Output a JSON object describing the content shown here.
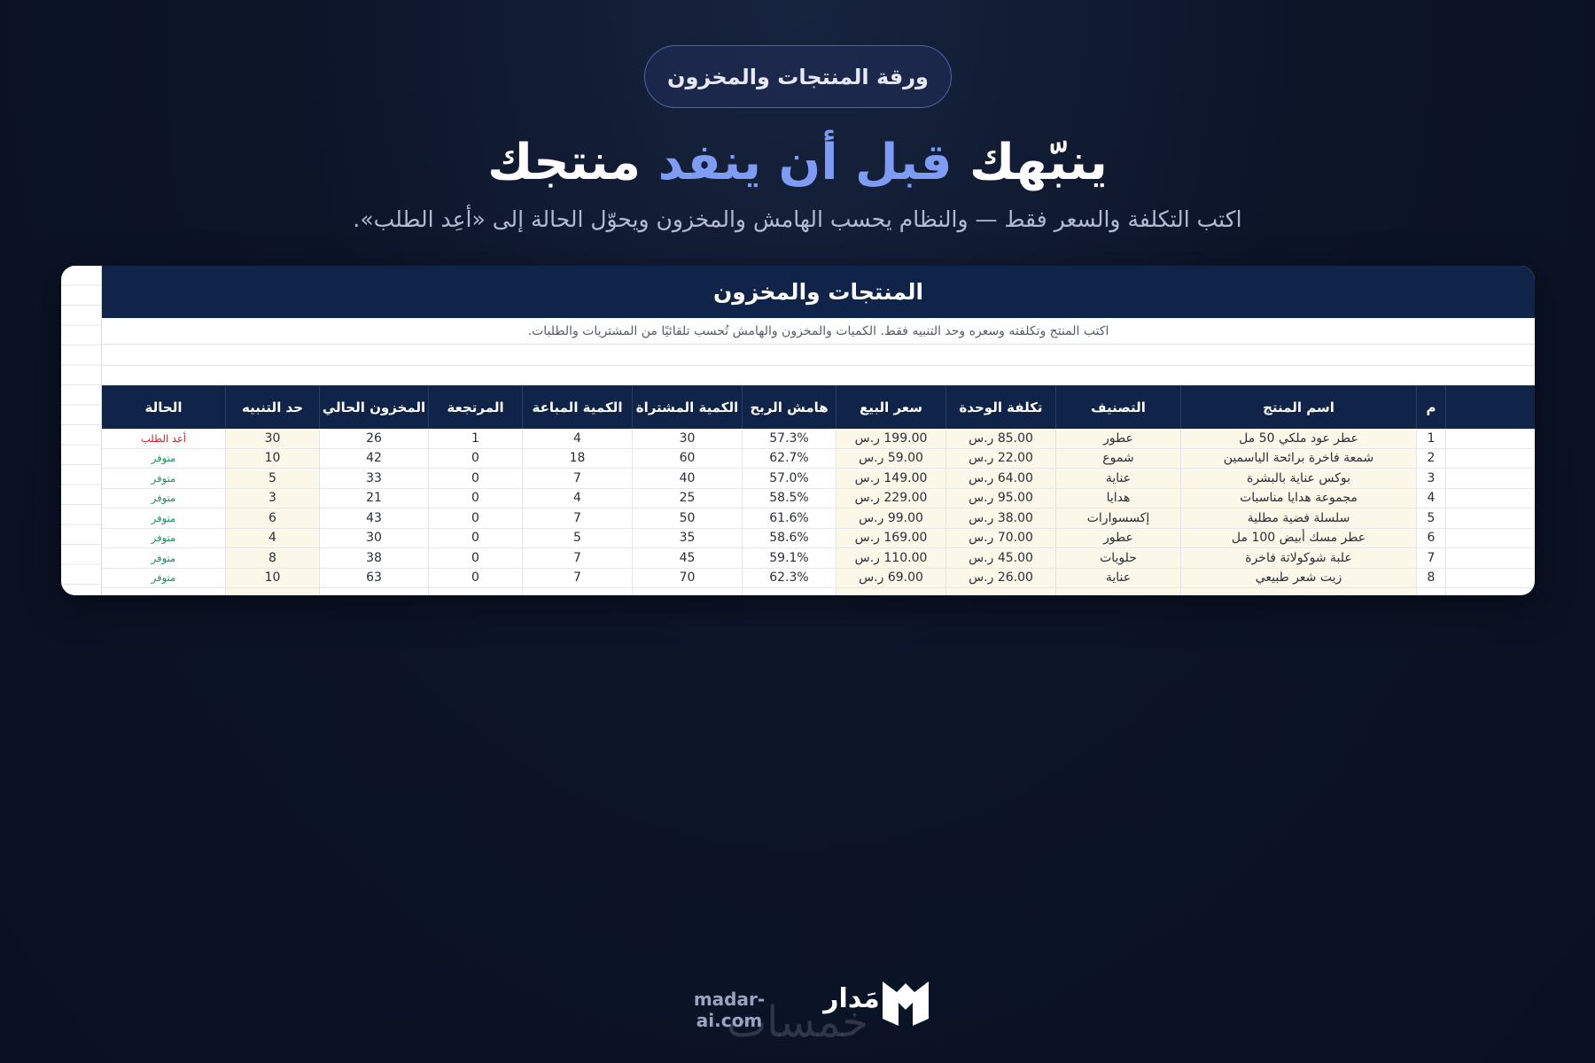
{
  "badge": "ورقة المنتجات والمخزون",
  "headline": {
    "part1": "ينبّهك ",
    "accent": "قبل أن ينفد",
    "part2": " منتجك"
  },
  "subtitle": "اكتب التكلفة والسعر فقط — والنظام يحسب الهامش والمخزون ويحوّل الحالة إلى «أعِد الطلب».",
  "sheet": {
    "title": "المنتجات والمخزون",
    "note": "اكتب المنتج وتكلفته وسعره وحد التنبيه فقط. الكميات والمخزون والهامش تُحسب تلقائيًا من المشتريات والطلبات.",
    "headers": {
      "idx": "م",
      "name": "اسم المنتج",
      "category": "التصنيف",
      "cost": "تكلفة الوحدة",
      "price": "سعر البيع",
      "margin": "هامش الربح",
      "bought": "الكمية المشتراة",
      "sold": "الكمية المباعة",
      "returned": "المرتجعة",
      "stock": "المخزون الحالي",
      "alert": "حد التنبيه",
      "status": "الحالة"
    },
    "rows": [
      {
        "idx": "1",
        "name": "عطر عود ملكي 50 مل",
        "category": "عطور",
        "cost": "85.00 ر.س",
        "price": "199.00 ر.س",
        "margin": "57.3%",
        "bought": "30",
        "sold": "4",
        "returned": "1",
        "stock": "26",
        "alert": "30",
        "status": "أعد الطلب",
        "status_color": "#c0262d"
      },
      {
        "idx": "2",
        "name": "شمعة فاخرة برائحة الياسمين",
        "category": "شموع",
        "cost": "22.00 ر.س",
        "price": "59.00 ر.س",
        "margin": "62.7%",
        "bought": "60",
        "sold": "18",
        "returned": "0",
        "stock": "42",
        "alert": "10",
        "status": "متوفر",
        "status_color": "#1f8a5b"
      },
      {
        "idx": "3",
        "name": "بوكس عناية بالبشرة",
        "category": "عناية",
        "cost": "64.00 ر.س",
        "price": "149.00 ر.س",
        "margin": "57.0%",
        "bought": "40",
        "sold": "7",
        "returned": "0",
        "stock": "33",
        "alert": "5",
        "status": "متوفر",
        "status_color": "#1f8a5b"
      },
      {
        "idx": "4",
        "name": "مجموعة هدايا مناسبات",
        "category": "هدايا",
        "cost": "95.00 ر.س",
        "price": "229.00 ر.س",
        "margin": "58.5%",
        "bought": "25",
        "sold": "4",
        "returned": "0",
        "stock": "21",
        "alert": "3",
        "status": "متوفر",
        "status_color": "#1f8a5b"
      },
      {
        "idx": "5",
        "name": "سلسلة فضية مطلية",
        "category": "إكسسوارات",
        "cost": "38.00 ر.س",
        "price": "99.00 ر.س",
        "margin": "61.6%",
        "bought": "50",
        "sold": "7",
        "returned": "0",
        "stock": "43",
        "alert": "6",
        "status": "متوفر",
        "status_color": "#1f8a5b"
      },
      {
        "idx": "6",
        "name": "عطر مسك أبيض 100 مل",
        "category": "عطور",
        "cost": "70.00 ر.س",
        "price": "169.00 ر.س",
        "margin": "58.6%",
        "bought": "35",
        "sold": "5",
        "returned": "0",
        "stock": "30",
        "alert": "4",
        "status": "متوفر",
        "status_color": "#1f8a5b"
      },
      {
        "idx": "7",
        "name": "علبة شوكولاتة فاخرة",
        "category": "حلويات",
        "cost": "45.00 ر.س",
        "price": "110.00 ر.س",
        "margin": "59.1%",
        "bought": "45",
        "sold": "7",
        "returned": "0",
        "stock": "38",
        "alert": "8",
        "status": "متوفر",
        "status_color": "#1f8a5b"
      },
      {
        "idx": "8",
        "name": "زيت شعر طبيعي",
        "category": "عناية",
        "cost": "26.00 ر.س",
        "price": "69.00 ر.س",
        "margin": "62.3%",
        "bought": "70",
        "sold": "7",
        "returned": "0",
        "stock": "63",
        "alert": "10",
        "status": "متوفر",
        "status_color": "#1f8a5b"
      }
    ]
  },
  "footer": {
    "site": "madar-ai.com",
    "brand": "مَدار",
    "watermark": "خمسات"
  },
  "colors": {
    "accent": "#7f9cf5",
    "header_bg": "#102348",
    "input_bg": "#fbf8ea",
    "alert_red": "#c0262d",
    "ok_green": "#1f8a5b"
  }
}
